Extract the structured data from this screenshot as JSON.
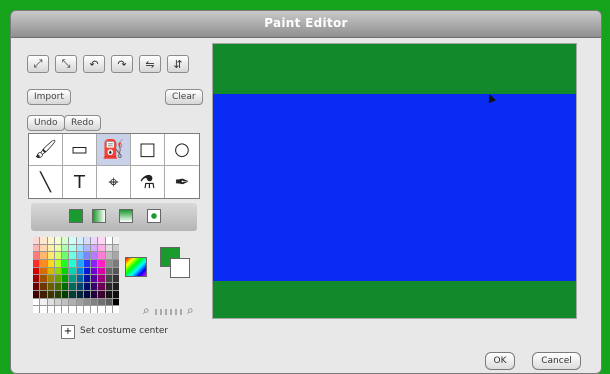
{
  "window": {
    "title": "Paint Editor"
  },
  "buttons": {
    "import": "Import",
    "clear": "Clear",
    "undo": "Undo",
    "redo": "Redo",
    "ok": "OK",
    "cancel": "Cancel"
  },
  "costume": {
    "set_center": "Set costume center"
  },
  "colors": {
    "background_green": "#14a31a",
    "canvas_green": "#128a2b",
    "canvas_blue": "#0a2bf4",
    "selected_tool": "#c8d1e8"
  },
  "tools": {
    "row1": [
      "brush-icon",
      "eraser-icon",
      "fill-bucket-icon",
      "rectangle-icon",
      "ellipse-icon"
    ],
    "row2": [
      "line-icon",
      "text-icon",
      "select-icon",
      "stamp-icon",
      "eyedropper-icon"
    ]
  }
}
